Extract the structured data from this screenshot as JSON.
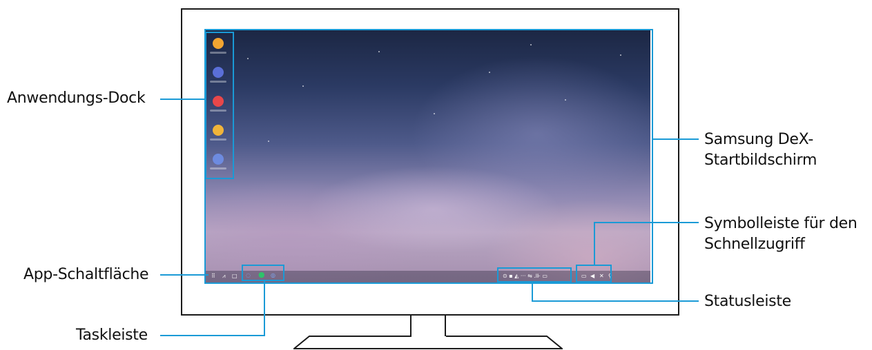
{
  "labels": {
    "dock": "Anwendungs-Dock",
    "app_button": "App-Schaltfläche",
    "taskbar": "Taskleiste",
    "home_line1": "Samsung DeX-",
    "home_line2": "Startbildschirm",
    "quick_line1": "Symbolleiste für den",
    "quick_line2": "Schnellzugriff",
    "status": "Statusleiste"
  },
  "dock_apps": [
    {
      "icon": "folder-icon",
      "color": "#f2a531"
    },
    {
      "icon": "internet-icon",
      "color": "#5a6fd8"
    },
    {
      "icon": "email-icon",
      "color": "#e8474a"
    },
    {
      "icon": "gallery-icon",
      "color": "#f0b43a"
    },
    {
      "icon": "settings-icon",
      "color": "#6d8be0"
    }
  ],
  "colors": {
    "callout": "#1a9ad6",
    "monitor_frame": "#1a1a1a"
  }
}
